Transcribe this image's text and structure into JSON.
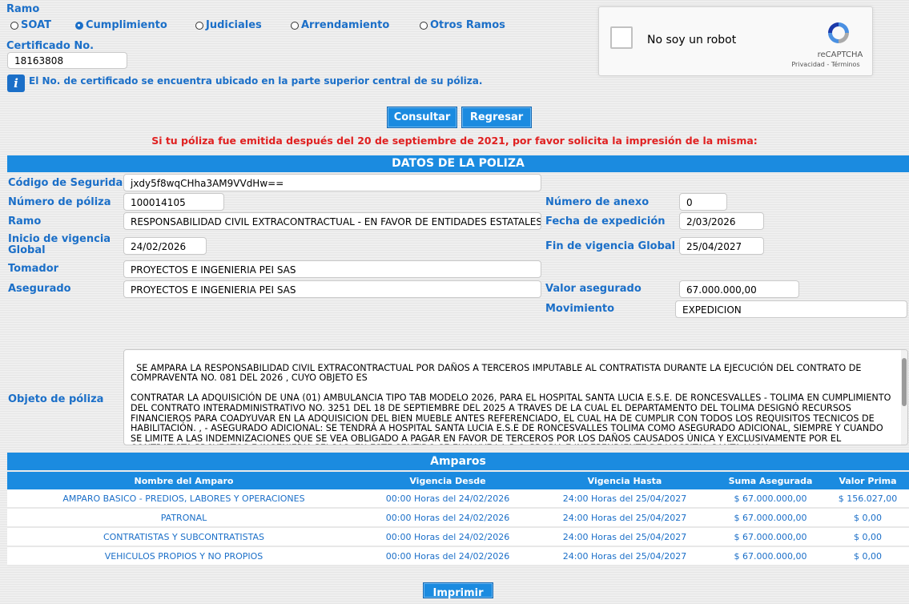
{
  "ramo": {
    "label": "Ramo",
    "options": [
      {
        "label": "SOAT",
        "selected": false
      },
      {
        "label": "Cumplimiento",
        "selected": true
      },
      {
        "label": "Judiciales",
        "selected": false
      },
      {
        "label": "Arrendamiento",
        "selected": false
      },
      {
        "label": "Otros Ramos",
        "selected": false
      }
    ]
  },
  "certificado": {
    "label": "Certificado No.",
    "value": "18163808"
  },
  "info_text": "El No. de certificado se encuentra ubicado en la parte superior central de su póliza.",
  "captcha": {
    "label": "No soy un robot",
    "brand": "reCAPTCHA",
    "links": "Privacidad - Términos"
  },
  "buttons": {
    "consultar": "Consultar",
    "regresar": "Regresar",
    "imprimir": "Imprimir"
  },
  "notice": "Si tu póliza fue emitida después del 20 de septiembre de 2021, por favor solicita la impresión de la misma:",
  "poliza": {
    "header": "DATOS DE LA POLIZA",
    "codigo_label": "Código de Seguridad",
    "codigo_value": "jxdy5f8wqCHha3AM9VVdHw==",
    "numero_label": "Número de póliza",
    "numero_value": "100014105",
    "anexo_label": "Número de anexo",
    "anexo_value": "0",
    "ramo_label": "Ramo",
    "ramo_value": "RESPONSABILIDAD CIVIL EXTRACONTRACTUAL - EN FAVOR DE ENTIDADES ESTATALES",
    "expedicion_label": "Fecha de expedición",
    "expedicion_value": "2/03/2026",
    "inicio_label": "Inicio de vigencia Global",
    "inicio_value": "24/02/2026",
    "fin_label": "Fin de vigencia Global",
    "fin_value": "25/04/2027",
    "tomador_label": "Tomador",
    "tomador_value": "PROYECTOS E INGENIERIA PEI SAS",
    "asegurado_label": "Asegurado",
    "asegurado_value": "PROYECTOS E INGENIERIA PEI SAS",
    "valor_label": "Valor asegurado",
    "valor_value": "67.000.000,00",
    "movimiento_label": "Movimiento",
    "movimiento_value": "EXPEDICION",
    "objeto_label": "Objeto de póliza",
    "objeto_value": "SE AMPARA LA RESPONSABILIDAD CIVIL EXTRACONTRACTUAL POR DAÑOS A TERCEROS IMPUTABLE AL CONTRATISTA DURANTE LA EJECUCIÓN DEL CONTRATO DE COMPRAVENTA NO. 081 DEL 2026 , CUYO OBJETO ES\n\nCONTRATAR LA ADQUISICIÓN DE UNA (01) AMBULANCIA TIPO TAB MODELO 2026, PARA EL HOSPITAL SANTA LUCIA E.S.E. DE RONCESVALLES - TOLIMA EN CUMPLIMIENTO DEL CONTRATO INTERADMINISTRATIVO NO. 3251 DEL 18 DE SEPTIEMBRE DEL 2025 A TRAVES DE LA CUAL EL DEPARTAMENTO DEL TOLIMA DESIGNÓ RECURSOS FINANCIEROS PARA COADYUVAR EN LA ADQUISICION DEL BIEN MUEBLE ANTES REFERENCIADO, EL CUAL HA DE CUMPLIR CON TODOS LOS REQUISITOS TECNICOS DE HABILITACIÓN. , - ASEGURADO ADICIONAL: SE TENDRÁ A HOSPITAL SANTA LUCIA E.S.E DE RONCESVALLES TOLIMA COMO ASEGURADO ADICIONAL, SIEMPRE Y CUANDO SE LIMITE A LAS INDEMNIZACIONES QUE SE VEA OBLIGADO A PAGAR EN FAVOR DE TERCEROS POR LOS DAÑOS CAUSADOS ÚNICA Y EXCLUSIVAMENTE POR EL CONTRATISTA PROYECTOS E INGENIERIA PEI SAS. EN ESTE SENTIDO SE EXCLUYE LA R.C. PROPIA E INDEPENDIENTE DE HOSPITAL SANTA LUCIA"
  },
  "amparos": {
    "header": "Amparos",
    "columns": [
      "Nombre del Amparo",
      "Vigencia Desde",
      "Vigencia Hasta",
      "Suma Asegurada",
      "Valor Prima"
    ],
    "rows": [
      [
        "AMPARO BASICO - PREDIOS, LABORES Y OPERACIONES",
        "00:00 Horas del 24/02/2026",
        "24:00 Horas del 25/04/2027",
        "$ 67.000.000,00",
        "$ 156.027,00"
      ],
      [
        "PATRONAL",
        "00:00 Horas del 24/02/2026",
        "24:00 Horas del 25/04/2027",
        "$ 67.000.000,00",
        "$ 0,00"
      ],
      [
        "CONTRATISTAS Y SUBCONTRATISTAS",
        "00:00 Horas del 24/02/2026",
        "24:00 Horas del 25/04/2027",
        "$ 67.000.000,00",
        "$ 0,00"
      ],
      [
        "VEHICULOS PROPIOS Y NO PROPIOS",
        "00:00 Horas del 24/02/2026",
        "24:00 Horas del 25/04/2027",
        "$ 67.000.000,00",
        "$ 0,00"
      ]
    ]
  },
  "colors": {
    "accent": "#1b8be0",
    "label": "#1b6fc8",
    "notice": "#e02020"
  }
}
